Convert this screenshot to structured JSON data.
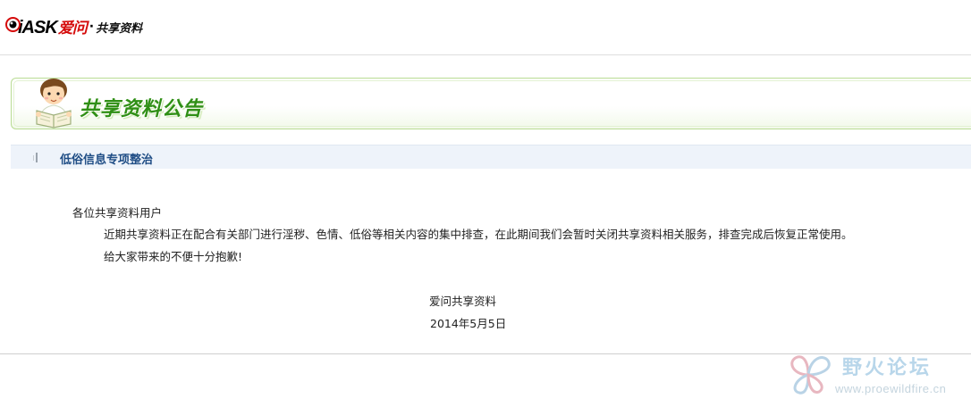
{
  "header": {
    "logo_brand": "iASK",
    "logo_brand_cn": "爱问",
    "logo_separator": "·",
    "logo_subtitle": "共享资料"
  },
  "banner": {
    "title": "共享资料公告"
  },
  "section": {
    "title": "低俗信息专项整治"
  },
  "notice": {
    "greeting": "各位共享资料用户",
    "paragraphs": [
      "近期共享资料正在配合有关部门进行淫秽、色情、低俗等相关内容的集中排查，在此期间我们会暂时关闭共享资料相关服务，排查完成后恢复正常使用。",
      "给大家带来的不便十分抱歉!"
    ],
    "signature": "爱问共享资料",
    "date": "2014年5月5日"
  },
  "watermark": {
    "title": "野火论坛",
    "url": "www.proewildfire.cn"
  },
  "colors": {
    "brand_red": "#d50b0b",
    "banner_green": "#2f8f15",
    "section_blue": "#1f4d85",
    "section_bg": "#eef3fa",
    "watermark_blue": "#b8d6ea"
  },
  "icons": {
    "logo_eye": "eye-logo-icon",
    "mascot": "reading-boy-icon",
    "section_marker": "section-marker-icon",
    "watermark_logo": "wildfire-logo-icon"
  }
}
